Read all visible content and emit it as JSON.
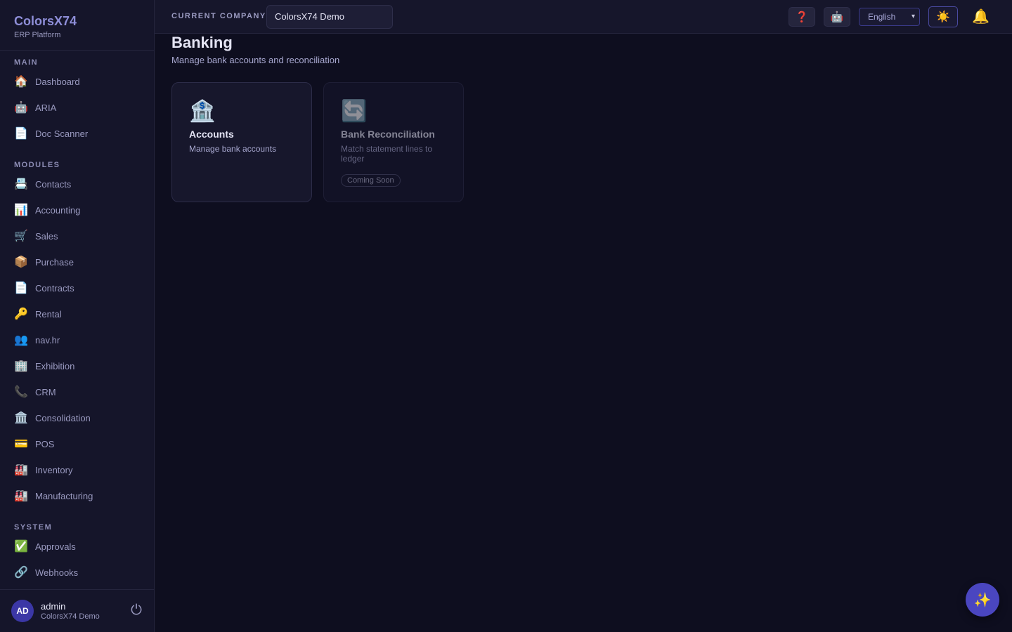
{
  "brand": {
    "title": "ColorsX74",
    "subtitle": "ERP Platform"
  },
  "sidebar": {
    "sections": [
      {
        "label": "MAIN",
        "items": [
          {
            "label": "Dashboard",
            "icon": "🏠"
          },
          {
            "label": "ARIA",
            "icon": "🤖"
          },
          {
            "label": "Doc Scanner",
            "icon": "📄"
          }
        ]
      },
      {
        "label": "MODULES",
        "items": [
          {
            "label": "Contacts",
            "icon": "📇"
          },
          {
            "label": "Accounting",
            "icon": "📊"
          },
          {
            "label": "Sales",
            "icon": "🛒"
          },
          {
            "label": "Purchase",
            "icon": "📦"
          },
          {
            "label": "Contracts",
            "icon": "📄"
          },
          {
            "label": "Rental",
            "icon": "🔑"
          },
          {
            "label": "nav.hr",
            "icon": "👥"
          },
          {
            "label": "Exhibition",
            "icon": "🏢"
          },
          {
            "label": "CRM",
            "icon": "📞"
          },
          {
            "label": "Consolidation",
            "icon": "🏛️"
          },
          {
            "label": "POS",
            "icon": "💳"
          },
          {
            "label": "Inventory",
            "icon": "🏭"
          },
          {
            "label": "Manufacturing",
            "icon": "🏭"
          }
        ]
      },
      {
        "label": "SYSTEM",
        "items": [
          {
            "label": "Approvals",
            "icon": "✅"
          },
          {
            "label": "Webhooks",
            "icon": "🔗"
          }
        ]
      }
    ]
  },
  "user": {
    "initials": "AD",
    "name": "admin",
    "company": "ColorsX74 Demo",
    "logout_icon": "⏻"
  },
  "topbar": {
    "company_label": "CURRENT COMPANY",
    "company_value": "ColorsX74 Demo",
    "help_icon": "❓",
    "robot_icon": "🤖",
    "language": "English",
    "theme_icon": "☀️",
    "bell_icon": "🔔"
  },
  "page": {
    "title": "Banking",
    "subtitle": "Manage bank accounts and reconciliation",
    "cards": [
      {
        "icon": "🏦",
        "title": "Accounts",
        "description": "Manage bank accounts",
        "badge": ""
      },
      {
        "icon": "🔄",
        "title": "Bank Reconciliation",
        "description": "Match statement lines to ledger",
        "badge": "Coming Soon"
      }
    ]
  },
  "fab_icon": "✨",
  "colors": {
    "accent": "#4a46c0",
    "brand": "#8e8ed8",
    "background": "#0e0e1f"
  }
}
